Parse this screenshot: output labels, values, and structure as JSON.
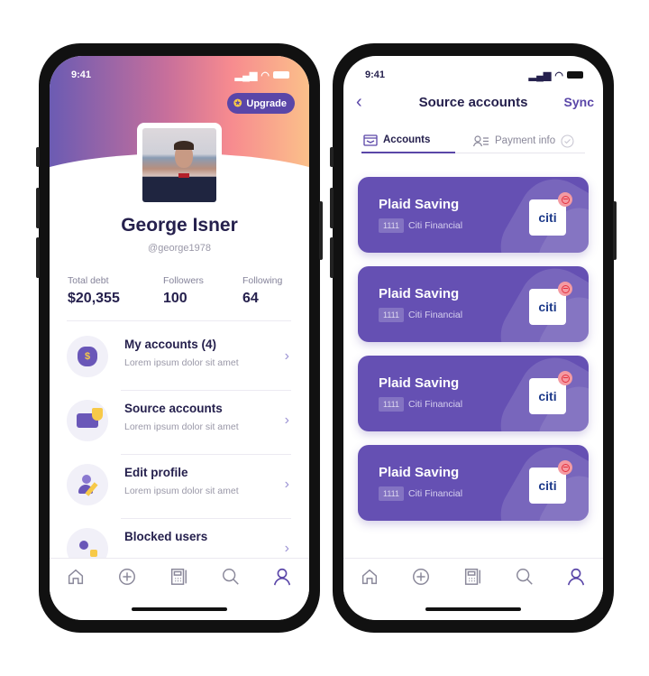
{
  "profile_screen": {
    "status": {
      "time": "9:41"
    },
    "upgrade_label": "Upgrade",
    "name": "George Isner",
    "handle": "@george1978",
    "stats": [
      {
        "label": "Total debt",
        "value": "$20,355"
      },
      {
        "label": "Followers",
        "value": "100"
      },
      {
        "label": "Following",
        "value": "64"
      }
    ],
    "menu": [
      {
        "title": "My accounts (4)",
        "subtitle": "Lorem ipsum dolor sit amet",
        "icon": "money-bag-icon"
      },
      {
        "title": "Source accounts",
        "subtitle": "Lorem ipsum dolor sit amet",
        "icon": "card-shield-icon"
      },
      {
        "title": "Edit profile",
        "subtitle": "Lorem ipsum dolor sit amet",
        "icon": "user-edit-icon"
      },
      {
        "title": "Blocked users",
        "subtitle": "",
        "icon": "users-lock-icon"
      }
    ],
    "nav": [
      "home-icon",
      "plus-circle-icon",
      "calculator-icon",
      "search-icon",
      "user-icon"
    ],
    "active_nav": "user-icon"
  },
  "source_screen": {
    "status": {
      "time": "9:41"
    },
    "title": "Source accounts",
    "sync_label": "Sync",
    "tabs": [
      {
        "label": "Accounts",
        "icon": "wallet-icon",
        "active": true
      },
      {
        "label": "Payment info",
        "icon": "user-list-icon",
        "active": false
      }
    ],
    "cards": [
      {
        "title": "Plaid Saving",
        "number": "1111",
        "bank": "Citi Financial",
        "logo": "citi"
      },
      {
        "title": "Plaid Saving",
        "number": "1111",
        "bank": "Citi Financial",
        "logo": "citi"
      },
      {
        "title": "Plaid Saving",
        "number": "1111",
        "bank": "Citi Financial",
        "logo": "citi"
      },
      {
        "title": "Plaid Saving",
        "number": "1111",
        "bank": "Citi Financial",
        "logo": "citi"
      }
    ]
  },
  "colors": {
    "accent": "#5a46a8",
    "card": "#6550b3",
    "text": "#25204d",
    "remove": "#e4323f"
  }
}
